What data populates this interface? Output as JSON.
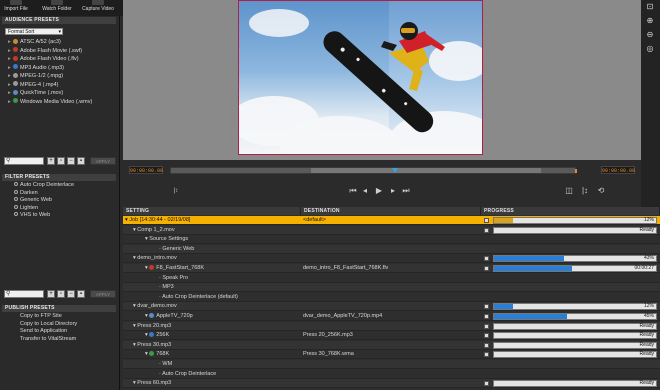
{
  "toolbar": {
    "import_file": "Import File",
    "watch_folder": "Watch Folder",
    "capture_video": "Capture Video"
  },
  "audience_presets": {
    "header": "AUDIENCE PRESETS",
    "format_select": "Format Sort",
    "items": [
      {
        "label": "ATSC A/52 (ac3)",
        "color": "#c88b3a"
      },
      {
        "label": "Adobe Flash Movie (.swf)",
        "color": "#c0392b"
      },
      {
        "label": "Adobe Flash Video (.flv)",
        "color": "#c0392b"
      },
      {
        "label": "MP3 Audio (.mp3)",
        "color": "#3a78c8"
      },
      {
        "label": "MPEG-1/2 (.mpg)",
        "color": "#9a9a9a"
      },
      {
        "label": "MPEG-4 (.mp4)",
        "color": "#9a9a9a"
      },
      {
        "label": "QuickTime (.mov)",
        "color": "#5a8ac8"
      },
      {
        "label": "Windows Media Video (.wmv)",
        "color": "#3a9a4a"
      }
    ],
    "apply": "APPLY"
  },
  "filter_presets": {
    "header": "FILTER PRESETS",
    "items": [
      "Auto Crop Deinterlace",
      "Darken",
      "Generic Web",
      "Lighten",
      "VHS to Web"
    ],
    "apply": "APPLY"
  },
  "publish_presets": {
    "header": "PUBLISH PRESETS",
    "items": [
      "Copy to FTP Site",
      "Copy to Local Directory",
      "Send to Application",
      "Transfer to VitalStream"
    ]
  },
  "timeline": {
    "timecode_in": "00:00:00.00",
    "timecode_out": "00:00:00.00"
  },
  "queue": {
    "headers": {
      "setting": "SETTING",
      "destination": "DESTINATION",
      "progress": "PROGRESS"
    },
    "rows": [
      {
        "setting": "Job [14:30:44 - 02/19/08]",
        "destination": "<default>",
        "status": "12%",
        "fill": 0.12,
        "type": "job",
        "indent": 2,
        "icon": "",
        "check": true
      },
      {
        "setting": "Comp 1_2.mov",
        "destination": "",
        "status": "Ready",
        "fill": 0,
        "type": "alt",
        "indent": 10,
        "icon": "",
        "check": true
      },
      {
        "setting": "Source Settings",
        "destination": "",
        "status": "",
        "fill": null,
        "type": "base",
        "indent": 22,
        "icon": "",
        "check": false
      },
      {
        "setting": "Generic Web",
        "destination": "",
        "status": "",
        "fill": null,
        "type": "alt",
        "indent": 36,
        "icon": "",
        "check": false
      },
      {
        "setting": "demo_intro.mov",
        "destination": "",
        "status": "43%",
        "fill": 0.43,
        "type": "base",
        "indent": 10,
        "icon": "",
        "check": true
      },
      {
        "setting": "F8_FastStart_768K",
        "destination": "demo_intro_F8_FastStart_768K.flv",
        "status": "00:00:27",
        "fill": 0.48,
        "type": "alt",
        "indent": 22,
        "icon": "#c0392b",
        "check": true
      },
      {
        "setting": "Speak Pro",
        "destination": "",
        "status": "",
        "fill": null,
        "type": "base",
        "indent": 36,
        "icon": "",
        "check": false
      },
      {
        "setting": "MP3",
        "destination": "",
        "status": "",
        "fill": null,
        "type": "alt",
        "indent": 36,
        "icon": "",
        "check": false
      },
      {
        "setting": "Auto Crop Deinterlace (default)",
        "destination": "",
        "status": "",
        "fill": null,
        "type": "base",
        "indent": 36,
        "icon": "",
        "check": false
      },
      {
        "setting": "dvar_demo.mov",
        "destination": "",
        "status": "12%",
        "fill": 0.12,
        "type": "alt",
        "indent": 10,
        "icon": "",
        "check": true
      },
      {
        "setting": "AppleTV_720p",
        "destination": "dvar_demo_AppleTV_720p.mp4",
        "status": "45%",
        "fill": 0.45,
        "type": "base",
        "indent": 22,
        "icon": "#5a8ac8",
        "check": true
      },
      {
        "setting": "Press 20.mp3",
        "destination": "",
        "status": "Ready",
        "fill": 0,
        "type": "alt",
        "indent": 10,
        "icon": "",
        "check": true
      },
      {
        "setting": "256K",
        "destination": "Press 20_256K.mp3",
        "status": "Ready",
        "fill": 0,
        "type": "base",
        "indent": 22,
        "icon": "#3a78c8",
        "check": true
      },
      {
        "setting": "Press 30.mp3",
        "destination": "",
        "status": "Ready",
        "fill": 0,
        "type": "alt",
        "indent": 10,
        "icon": "",
        "check": true
      },
      {
        "setting": "768K",
        "destination": "Press 30_768K.wma",
        "status": "Ready",
        "fill": 0,
        "type": "base",
        "indent": 22,
        "icon": "#3a9a4a",
        "check": true
      },
      {
        "setting": "WM",
        "destination": "",
        "status": "",
        "fill": null,
        "type": "alt",
        "indent": 36,
        "icon": "",
        "check": false
      },
      {
        "setting": "Auto Crop Deinterlace",
        "destination": "",
        "status": "",
        "fill": null,
        "type": "base",
        "indent": 36,
        "icon": "",
        "check": false
      },
      {
        "setting": "Press 60.mp3",
        "destination": "",
        "status": "Ready",
        "fill": 0,
        "type": "alt",
        "indent": 10,
        "icon": "",
        "check": true
      }
    ]
  }
}
